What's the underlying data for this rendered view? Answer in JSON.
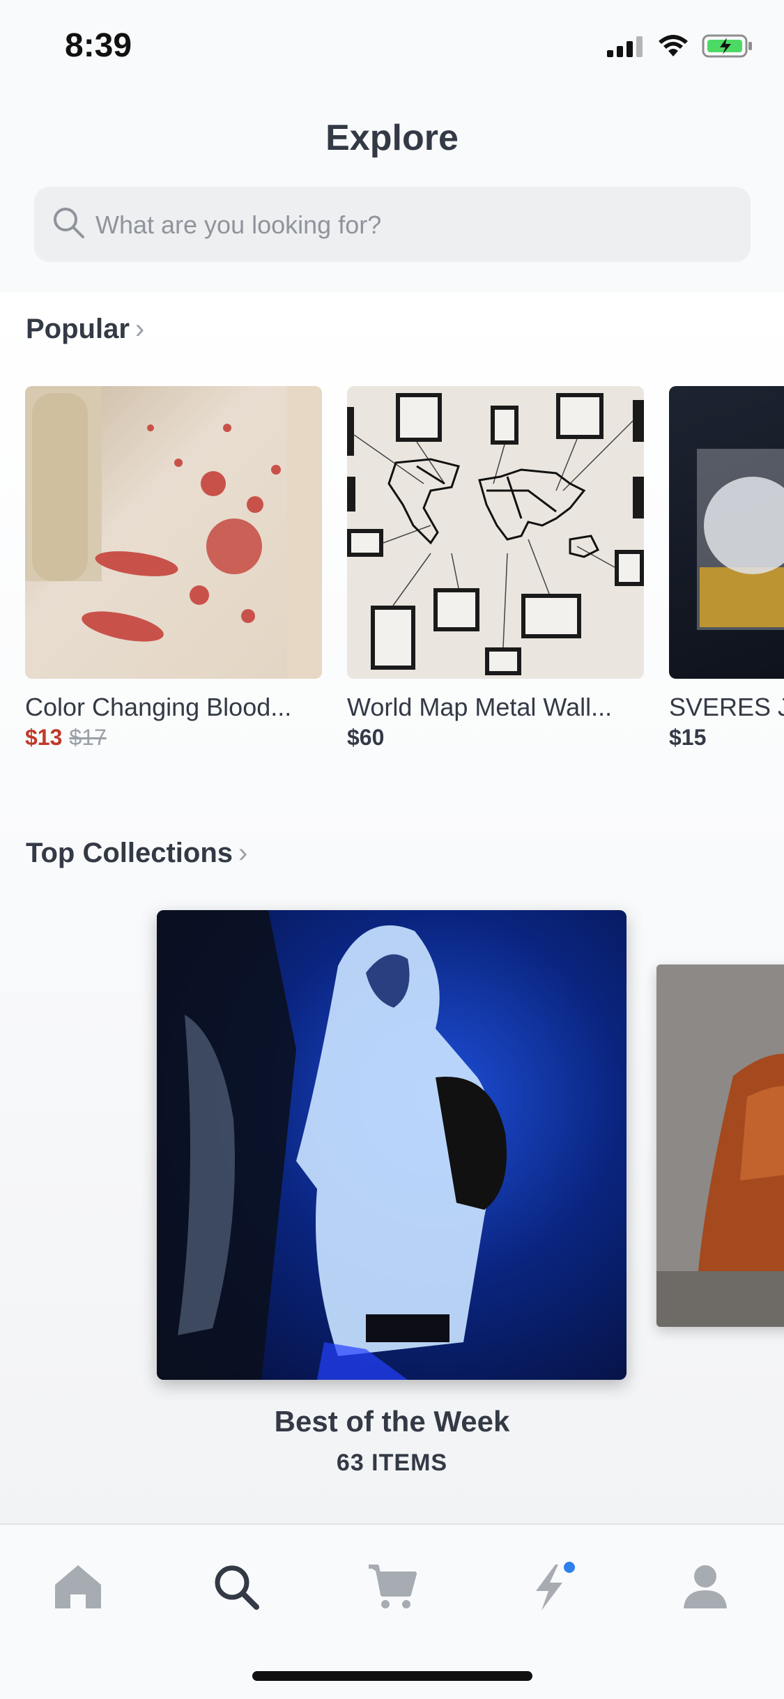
{
  "status": {
    "time": "8:39"
  },
  "header": {
    "title": "Explore"
  },
  "search": {
    "placeholder": "What are you looking for?"
  },
  "popular": {
    "title": "Popular",
    "items": [
      {
        "name": "Color Changing Blood...",
        "price_sale": "$13",
        "price_original": "$17"
      },
      {
        "name": "World Map Metal Wall...",
        "price": "$60"
      },
      {
        "name": "SVERES J",
        "price": "$15"
      }
    ]
  },
  "collections": {
    "title": "Top Collections",
    "featured": {
      "name": "Best of the Week",
      "count": "63 ITEMS"
    }
  },
  "tabbar": {
    "items": [
      "home-icon",
      "search-icon",
      "cart-icon",
      "lightning-icon",
      "profile-icon"
    ],
    "active": "search-icon",
    "notification_color": "#2f80ed"
  },
  "colors": {
    "sale": "#c0392b",
    "text": "#333a45",
    "muted": "#9aa0a7"
  }
}
